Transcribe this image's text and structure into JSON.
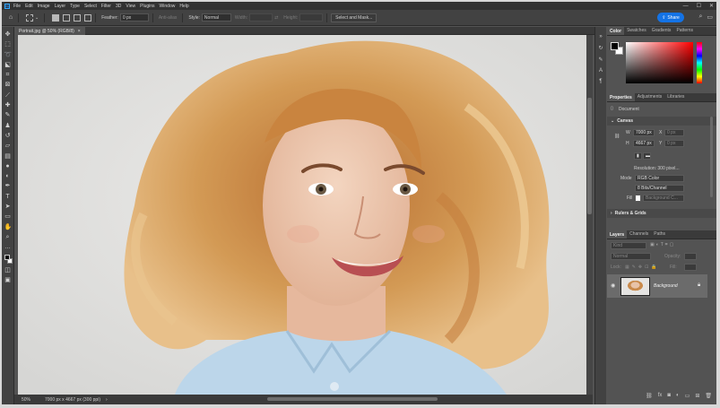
{
  "app": {
    "logo": "Ps"
  },
  "menu": [
    "File",
    "Edit",
    "Image",
    "Layer",
    "Type",
    "Select",
    "Filter",
    "3D",
    "View",
    "Plugins",
    "Window",
    "Help"
  ],
  "window_controls": {
    "minimize": "—",
    "maximize": "☐",
    "close": "✕"
  },
  "options_bar": {
    "feather_label": "Feather:",
    "feather_value": "0 px",
    "anti_alias_label": "Anti-alias",
    "style_label": "Style:",
    "style_value": "Normal",
    "width_label": "Width:",
    "height_label": "Height:",
    "select_and_mask": "Select and Mask...",
    "share_label": "Share"
  },
  "document": {
    "tab_title": "Portrait.jpg @ 50% (RGB/8)",
    "tab_close": "×"
  },
  "status": {
    "zoom": "50%",
    "info": "7000 px x 4667 px (300 ppi)",
    "arrow": "›"
  },
  "color_panel": {
    "tabs": [
      "Color",
      "Swatches",
      "Gradients",
      "Patterns"
    ],
    "foreground": "#000000",
    "background": "#ffffff"
  },
  "properties_panel": {
    "tabs": [
      "Properties",
      "Adjustments",
      "Libraries"
    ],
    "document_label": "Document",
    "canvas_section": "Canvas",
    "w_label": "W",
    "w_value": "7000 px",
    "x_label": "X",
    "x_value": "0 px",
    "h_label": "H",
    "h_value": "4667 px",
    "y_label": "Y",
    "y_value": "0 px",
    "resolution": "Resolution: 300 pixel...",
    "mode_label": "Mode",
    "mode_value": "RGB Color",
    "bit_depth": "8 Bits/Channel",
    "fill_label": "Fill",
    "fill_value": "Background C...",
    "rulers_section": "Rulers & Grids"
  },
  "layers_panel": {
    "tabs": [
      "Layers",
      "Channels",
      "Paths"
    ],
    "kind_placeholder": "Kind",
    "blend_mode": "Normal",
    "opacity_label": "Opacity:",
    "lock_label": "Lock:",
    "fill_label": "Fill:",
    "layer_name": "Background"
  }
}
